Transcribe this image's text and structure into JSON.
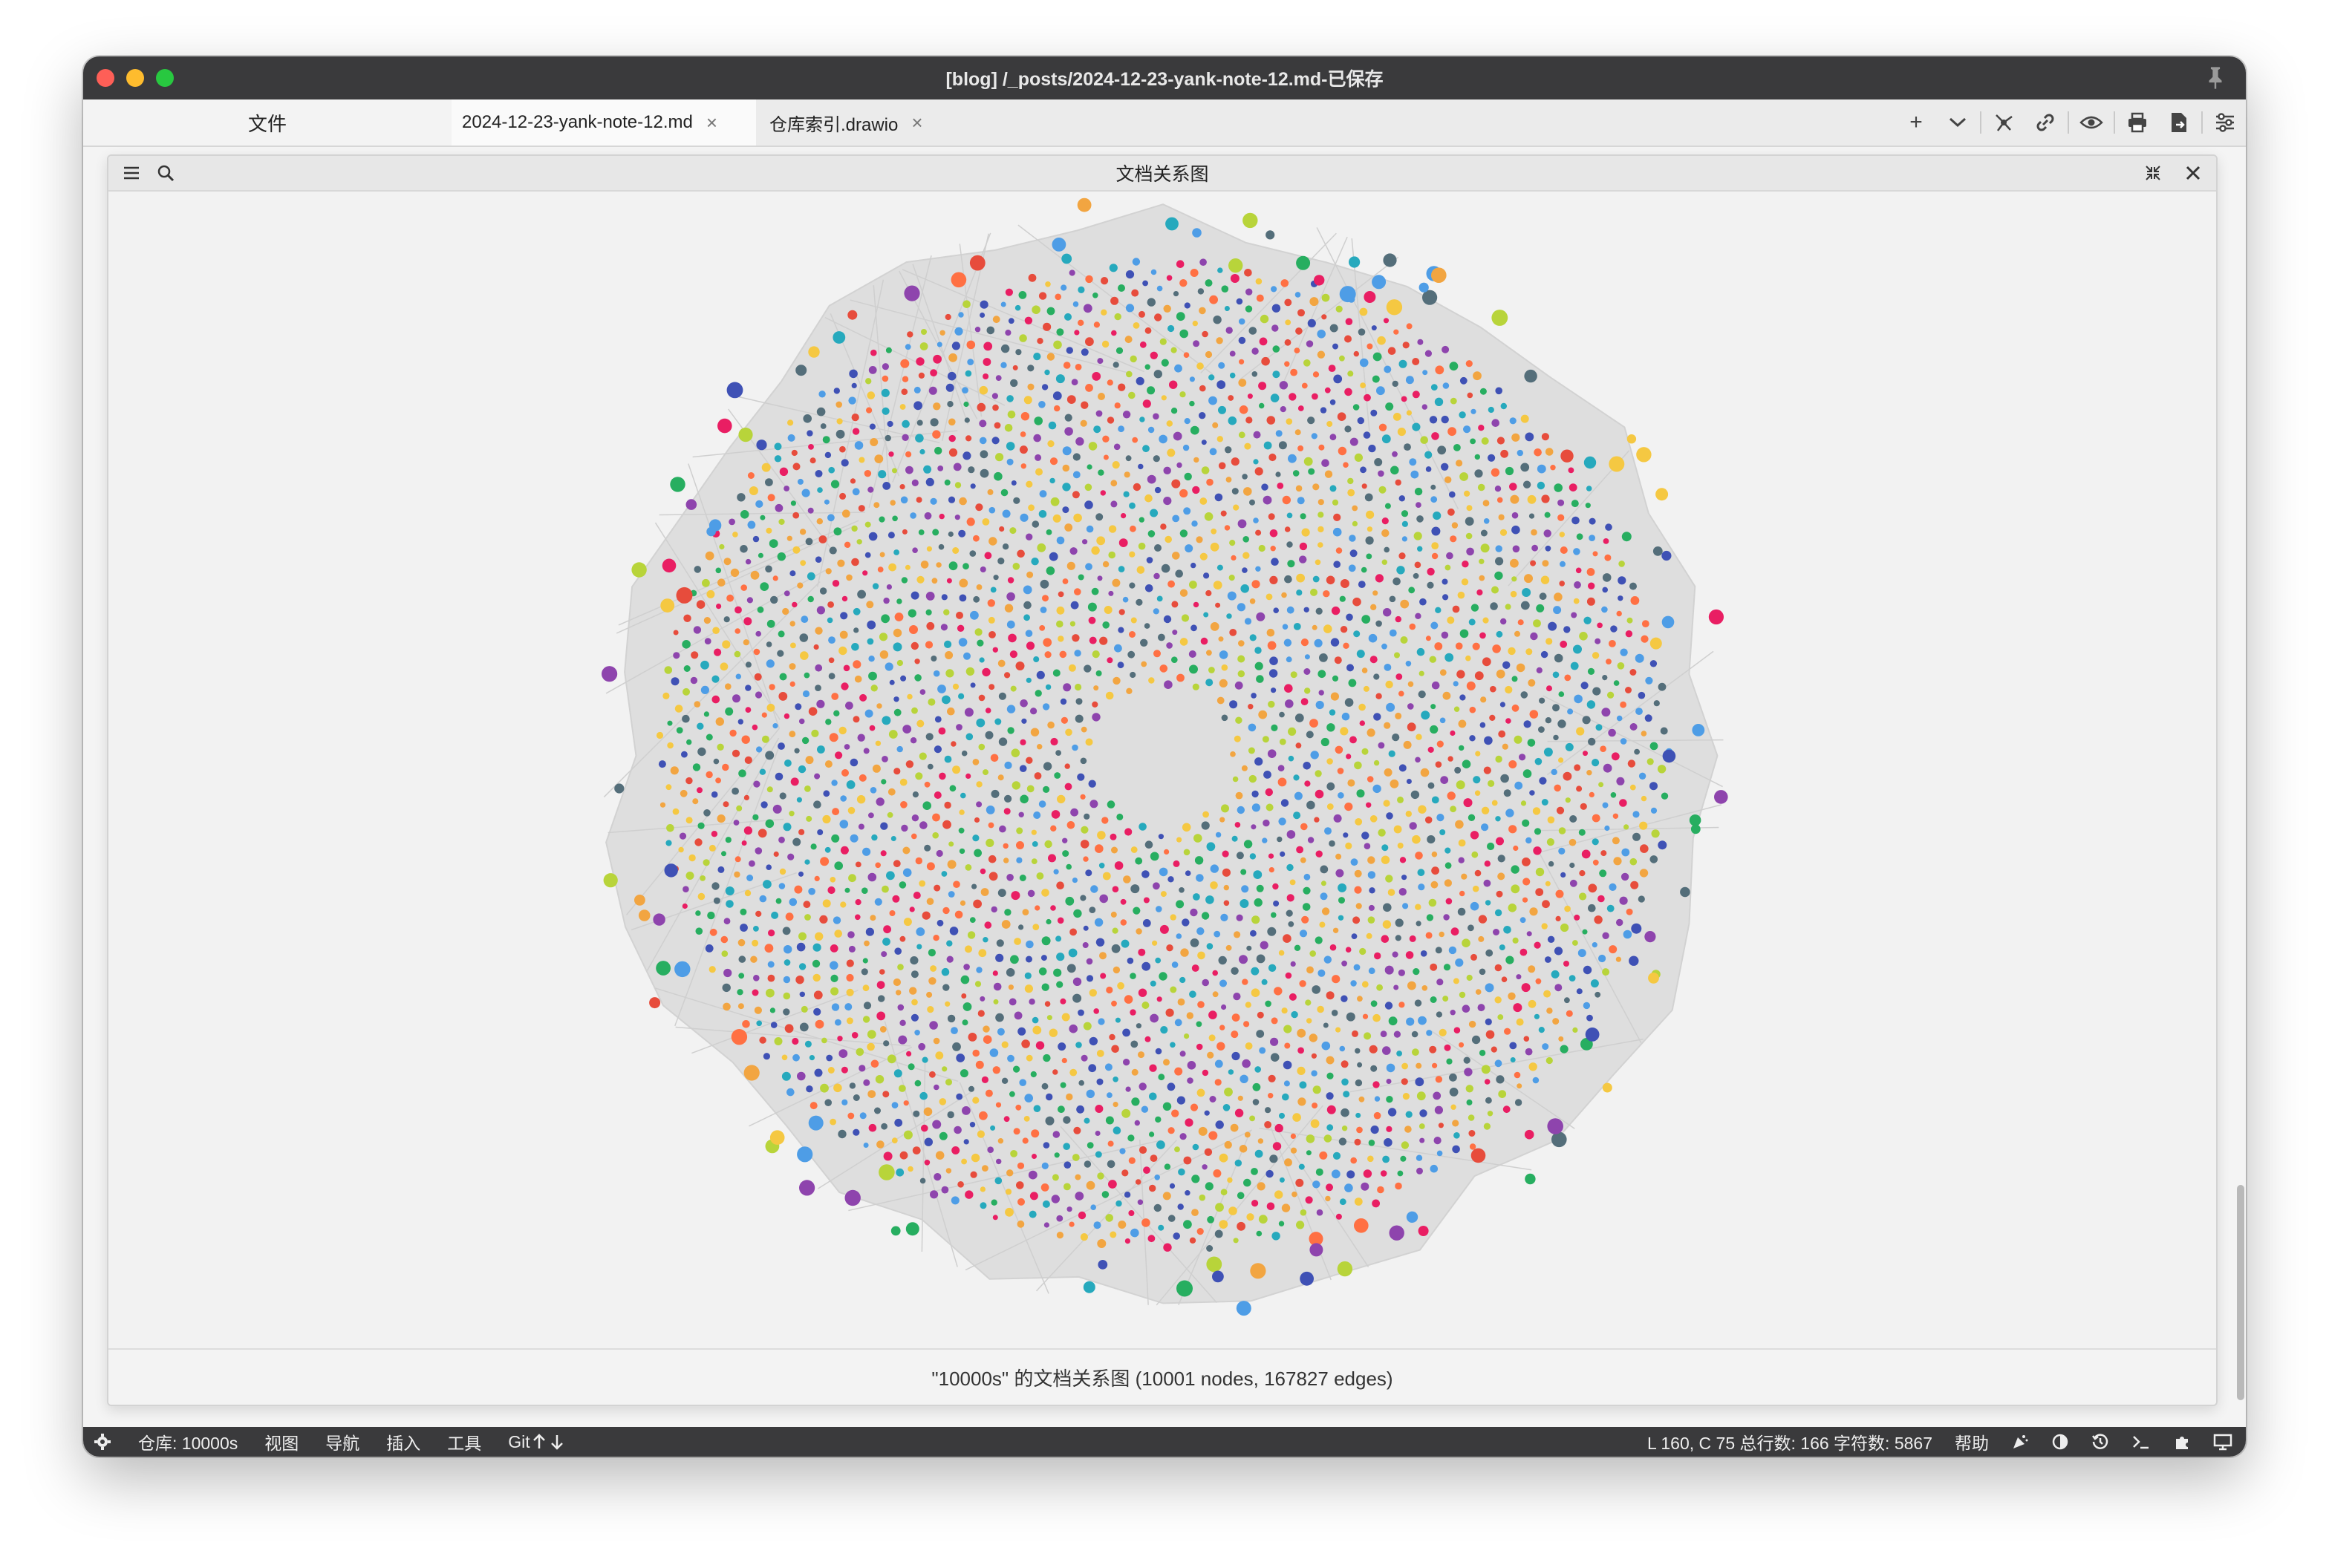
{
  "window": {
    "title": "[blog] /_posts/2024-12-23-yank-note-12.md-已保存"
  },
  "sidebar": {
    "tab_label": "文件"
  },
  "tabs": [
    {
      "label": "2024-12-23-yank-note-12.md",
      "active": true
    },
    {
      "label": "仓库索引.drawio",
      "active": false
    }
  ],
  "toolbar": {
    "icons": [
      "plus-icon",
      "chevron-down-icon",
      "graph-icon",
      "link-icon",
      "eye-icon",
      "print-icon",
      "export-icon",
      "settings-icon"
    ]
  },
  "panel": {
    "title": "文档关系图",
    "footer": "\"10000s\" 的文档关系图 (10001 nodes, 167827 edges)"
  },
  "graph": {
    "colors": [
      "#4e9de6",
      "#f2a541",
      "#e74c3c",
      "#8e44ad",
      "#27ae60",
      "#b8d43a",
      "#26a9bd",
      "#3f51b5",
      "#ff7043",
      "#546e7a",
      "#e91e63",
      "#f5c842"
    ]
  },
  "statusbar": {
    "repo": "仓库: 10000s",
    "view": "视图",
    "nav": "导航",
    "insert": "插入",
    "tools": "工具",
    "git": "Git",
    "position": "L 160, C 75 总行数: 166 字符数: 5867",
    "help": "帮助"
  }
}
